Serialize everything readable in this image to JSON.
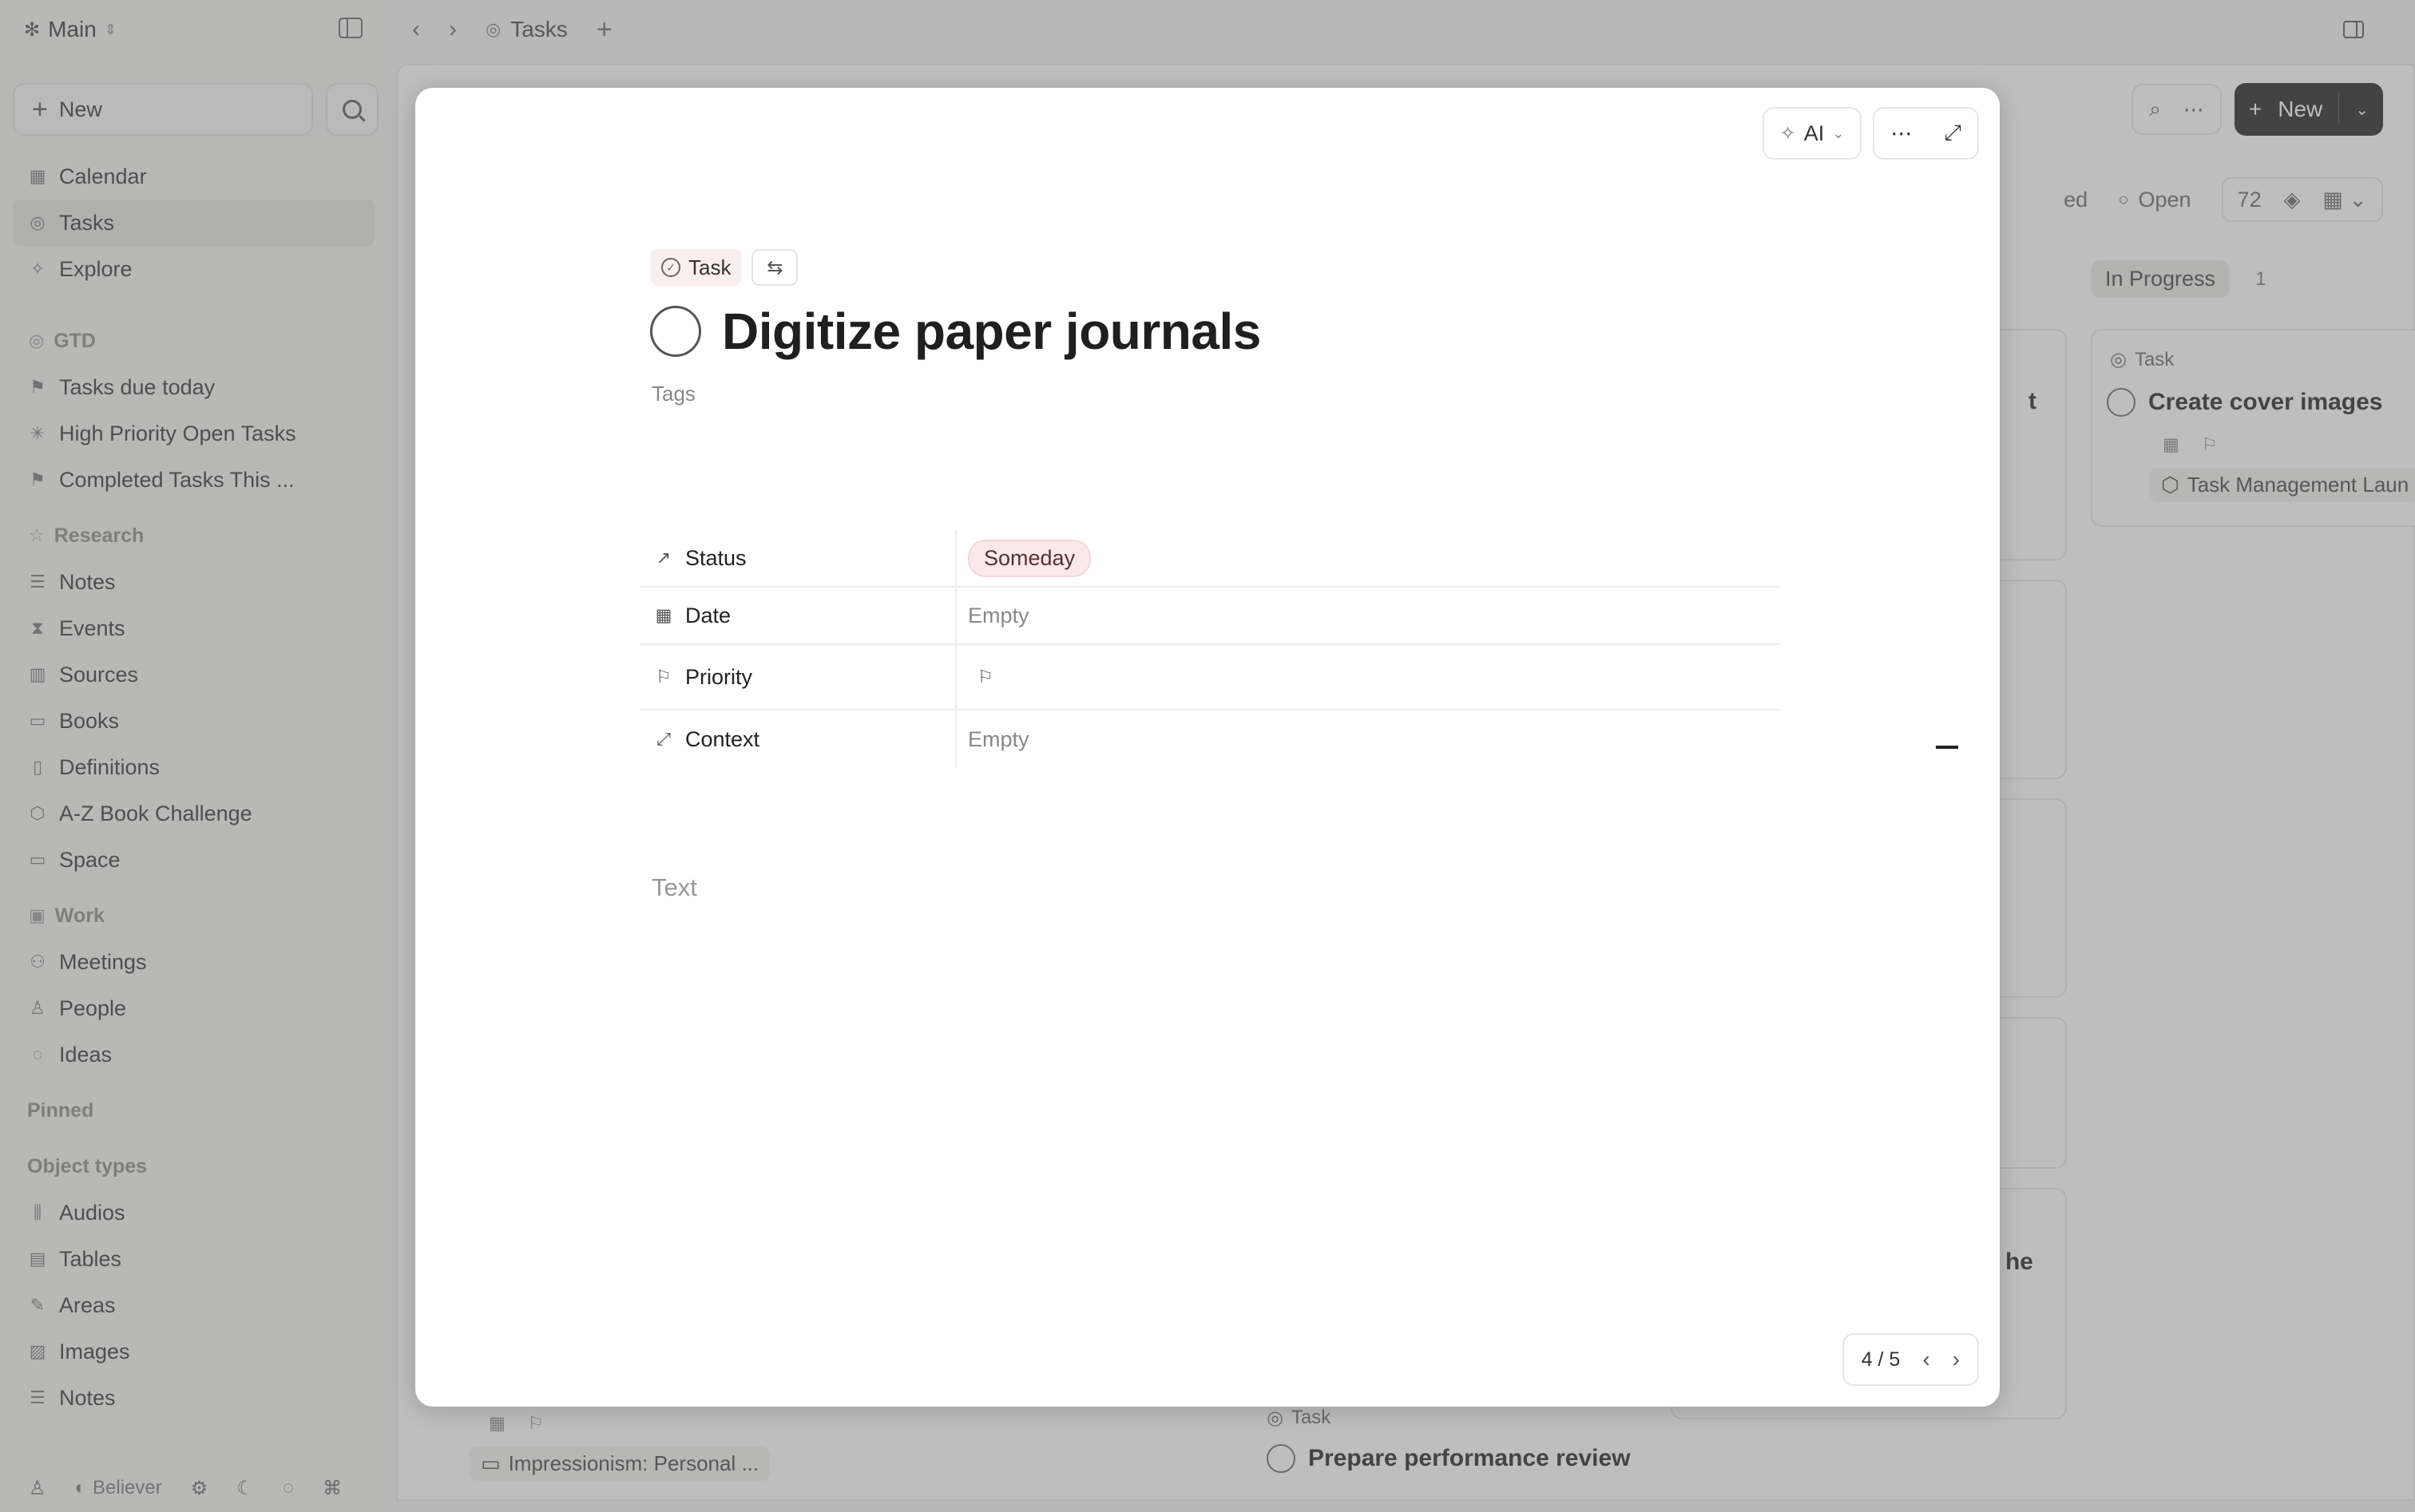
{
  "workspace": {
    "name": "Main"
  },
  "topbar": {
    "tab_label": "Tasks"
  },
  "sidebar": {
    "new_label": "New",
    "primary": [
      {
        "icon": "calendar-icon",
        "glyph": "▦",
        "label": "Calendar"
      },
      {
        "icon": "check-circle-icon",
        "glyph": "◎",
        "label": "Tasks",
        "active": true
      },
      {
        "icon": "sparkle-icon",
        "glyph": "✧",
        "label": "Explore"
      }
    ],
    "sections": [
      {
        "label": "GTD",
        "icon": "check-circle-icon",
        "glyph": "◎",
        "items": [
          {
            "icon": "flag-icon",
            "glyph": "⚑",
            "label": "Tasks due today"
          },
          {
            "icon": "asterisk-icon",
            "glyph": "✳",
            "label": "High Priority Open Tasks"
          },
          {
            "icon": "flag-icon",
            "glyph": "⚑",
            "label": "Completed Tasks This ..."
          }
        ]
      },
      {
        "label": "Research",
        "icon": "star-icon",
        "glyph": "☆",
        "items": [
          {
            "icon": "notes-icon",
            "glyph": "☰",
            "label": "Notes"
          },
          {
            "icon": "hourglass-icon",
            "glyph": "⧗",
            "label": "Events"
          },
          {
            "icon": "library-icon",
            "glyph": "▥",
            "label": "Sources"
          },
          {
            "icon": "book-icon",
            "glyph": "▭",
            "label": "Books"
          },
          {
            "icon": "bookmark-icon",
            "glyph": "▯",
            "label": "Definitions"
          },
          {
            "icon": "cube-icon",
            "glyph": "⬡",
            "label": "A-Z Book Challenge"
          },
          {
            "icon": "book-open-icon",
            "glyph": "▭",
            "label": "Space"
          }
        ]
      },
      {
        "label": "Work",
        "icon": "briefcase-icon",
        "glyph": "▣",
        "items": [
          {
            "icon": "people-icon",
            "glyph": "⚇",
            "label": "Meetings"
          },
          {
            "icon": "person-icon",
            "glyph": "♙",
            "label": "People"
          },
          {
            "icon": "lightbulb-icon",
            "glyph": "◌",
            "label": "Ideas"
          }
        ]
      }
    ],
    "pinned_label": "Pinned",
    "object_types_label": "Object types",
    "object_types": [
      {
        "icon": "audio-icon",
        "glyph": "⫼",
        "label": "Audios"
      },
      {
        "icon": "table-icon",
        "glyph": "▤",
        "label": "Tables"
      },
      {
        "icon": "edit-icon",
        "glyph": "✎",
        "label": "Areas"
      },
      {
        "icon": "image-icon",
        "glyph": "▨",
        "label": "Images"
      },
      {
        "icon": "notes-icon",
        "glyph": "☰",
        "label": "Notes"
      }
    ],
    "footer": {
      "user_label": "Believer"
    }
  },
  "background": {
    "new_label": "New",
    "filters": {
      "partial_label": "ed",
      "open_label": "Open",
      "count": "72"
    },
    "column": {
      "status": "In Progress",
      "count": "1"
    },
    "card_right": {
      "type": "Task",
      "title": "Create cover images",
      "ref": "Task Management Laun"
    },
    "card_bottom_mid": {
      "type": "Task",
      "title": "Prepare performance review"
    },
    "card_bottom_left": {
      "ref": "Impressionism: Personal ..."
    },
    "frag_t": "t",
    "frag_the": "he"
  },
  "modal": {
    "ai_label": "AI",
    "type_label": "Task",
    "title": "Digitize paper journals",
    "tags_label": "Tags",
    "properties": [
      {
        "icon": "trend-up-icon",
        "glyph": "↗",
        "name": "Status",
        "value": "Someday",
        "kind": "pill"
      },
      {
        "icon": "calendar-icon",
        "glyph": "▦",
        "name": "Date",
        "value": "Empty",
        "kind": "empty"
      },
      {
        "icon": "flag-icon",
        "glyph": "⚐",
        "name": "Priority",
        "value": "",
        "kind": "flag"
      },
      {
        "icon": "link-icon",
        "glyph": "⤢",
        "name": "Context",
        "value": "Empty",
        "kind": "empty"
      }
    ],
    "text_placeholder": "Text",
    "pager": "4 / 5"
  }
}
